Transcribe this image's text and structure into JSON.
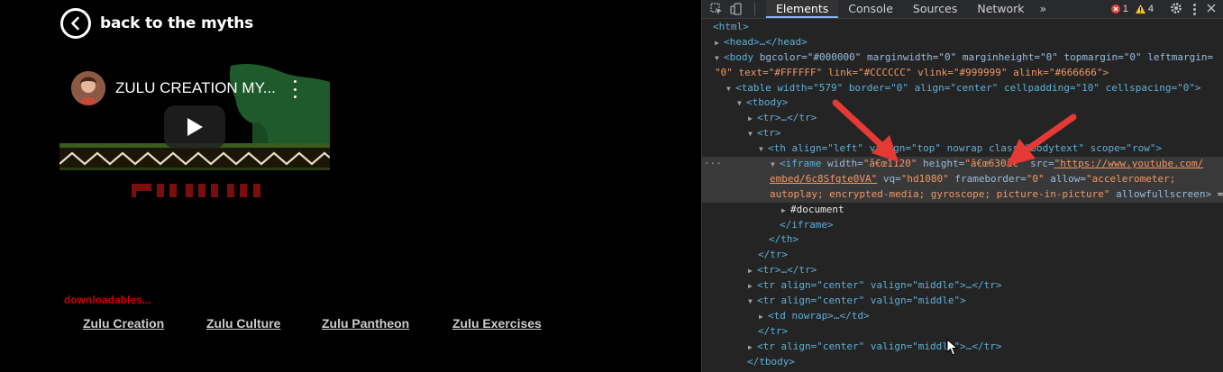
{
  "page": {
    "back_label": "back to the myths",
    "video": {
      "title": "ZULU CREATION MY..."
    },
    "downloadables_label": "downloadables...",
    "links": [
      "Zulu Creation",
      "Zulu Culture",
      "Zulu Pantheon",
      "Zulu Exercises"
    ]
  },
  "devtools": {
    "tabs": [
      "Elements",
      "Console",
      "Sources",
      "Network"
    ],
    "more": "»",
    "errors": "1",
    "warnings": "4",
    "lines": {
      "l0": "<html>",
      "l1": "<head>…</head>",
      "l2_open": "<body",
      "l2_attrs": " bgcolor=\"#000000\" marginwidth=\"0\" marginheight=\"0\" topmargin=\"0\" leftmargin=",
      "l3": "\"0\" text=\"#FFFFFF\" link=\"#CCCCCC\" vlink=\"#999999\" alink=\"#666666\">",
      "l4": "<table width=\"579\" border=\"0\" align=\"center\" cellpadding=\"10\" cellspacing=\"0\">",
      "l5": "<tbody>",
      "l6": "<tr>…</tr>",
      "l7": "<tr>",
      "l8": "<th align=\"left\" valign=\"top\" nowrap class=\"bodytext\" scope=\"row\">",
      "l9_tag": "<iframe",
      "l9_w_attr": " width=",
      "l9_w_val": "\"â€œ1120\"",
      "l9_h_attr": " height=",
      "l9_h_val": "\"â€œ630â€\"",
      "l9_src_attr": " src=",
      "l9_src_val": "\"https://www.youtube.com/",
      "l10_src_val": "embed/6c8Sfgte0VA\"",
      "l10_vq_attr": " vq=",
      "l10_vq_val": "\"hd1080\"",
      "l10_fb_attr": " frameborder=",
      "l10_fb_val": "\"0\"",
      "l10_allow_attr": " allow=",
      "l10_allow_val": "\"accelerometer;",
      "l11_allow_val": "autoplay; encrypted-media; gyroscope; picture-in-picture\"",
      "l11_afs": " allowfullscreen>",
      "l11_end": " ==",
      "l12": "#document",
      "l13": "</iframe>",
      "l14": "</th>",
      "l15": "</tr>",
      "l16": "<tr>…</tr>",
      "l17": "<tr align=\"center\" valign=\"middle\">…</tr>",
      "l18": "<tr align=\"center\" valign=\"middle\">",
      "l19": "<td nowrap>…</td>",
      "l20": "</tr>",
      "l21": "<tr align=\"center\" valign=\"middle\">…</tr>",
      "l22": "</tbody>"
    }
  },
  "colors": {
    "arrow": "#e53935",
    "link": "#cccccc",
    "downloadables": "#cc0000"
  }
}
